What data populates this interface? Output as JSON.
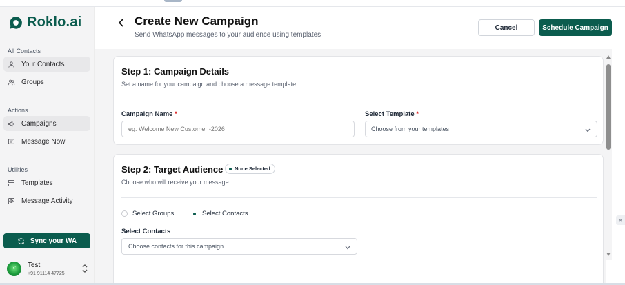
{
  "brand": {
    "name": "Roklo.ai",
    "color": "#0b5c4e"
  },
  "sidebar": {
    "sections": [
      {
        "label": "All Contacts",
        "items": [
          {
            "label": "Your Contacts",
            "icon": "user-icon",
            "active": true
          },
          {
            "label": "Groups",
            "icon": "users-icon",
            "active": false
          }
        ]
      },
      {
        "label": "Actions",
        "items": [
          {
            "label": "Campaigns",
            "icon": "megaphone-icon",
            "active": true
          },
          {
            "label": "Message Now",
            "icon": "message-icon",
            "active": false
          }
        ]
      },
      {
        "label": "Utilities",
        "items": [
          {
            "label": "Templates",
            "icon": "templates-icon",
            "active": false
          },
          {
            "label": "Message Activity",
            "icon": "eye-icon",
            "active": false
          }
        ]
      }
    ],
    "sync_label": "Sync your WA",
    "user": {
      "name": "Test",
      "phone": "+91 91114 47725"
    }
  },
  "header": {
    "title": "Create New Campaign",
    "subtitle": "Send WhatsApp messages to your audience using templates",
    "cancel_label": "Cancel",
    "schedule_label": "Schedule Campaign"
  },
  "step1": {
    "title": "Step 1: Campaign Details",
    "subtitle": "Set a name for your campaign and choose a message template",
    "name_label": "Campaign Name",
    "name_placeholder": "eg: Welcome New Customer -2026",
    "template_label": "Select Template",
    "template_placeholder": "Choose from your templates",
    "required_mark": "*"
  },
  "step2": {
    "title": "Step 2: Target Audience",
    "subtitle": "Choose who will receive your message",
    "badge": "None Selected",
    "option_groups": "Select Groups",
    "option_contacts": "Select Contacts",
    "selected_option": "contacts",
    "contacts_label": "Select Contacts",
    "contacts_placeholder": "Choose contacts for this campaign"
  }
}
